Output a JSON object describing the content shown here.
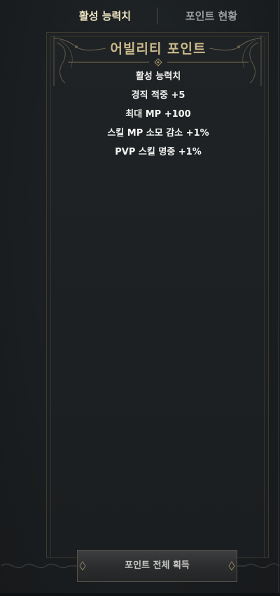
{
  "tabs": {
    "active_label": "활성 능력치",
    "inactive_label": "포인트 현황"
  },
  "panel": {
    "title": "어빌리티 포인트",
    "stats": [
      "활성 능력치",
      "경직 적중 +5",
      "최대 MP +100",
      "스킬 MP 소모 감소 +1%",
      "PVP 스킬 명중 +1%"
    ]
  },
  "footer": {
    "claim_all_label": "포인트 전체 획득"
  },
  "colors": {
    "background": "#1c1f21",
    "active_tab": "#f1e7c6",
    "inactive_tab": "#9a9d9f",
    "title_gold": "#cbb98c",
    "stat_text": "#f4f4f2"
  },
  "icons": {
    "corner": "filigree-corner-icon",
    "divider": "ornament-divider-icon",
    "button_gem": "gem-icon"
  }
}
